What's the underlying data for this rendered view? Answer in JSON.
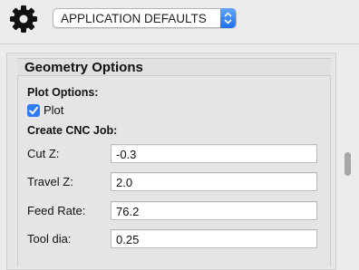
{
  "header": {
    "gear_icon": "gear-icon",
    "dropdown": {
      "selected": "APPLICATION DEFAULTS",
      "icon": "chevron-updown-icon"
    }
  },
  "section": {
    "title": "Geometry Options",
    "plot_options_label": "Plot Options:",
    "plot_checkbox": {
      "label": "Plot",
      "checked": true
    },
    "create_cnc_job_label": "Create CNC Job:",
    "fields": [
      {
        "label": "Cut Z:",
        "value": "-0.3"
      },
      {
        "label": "Travel Z:",
        "value": "2.0"
      },
      {
        "label": "Feed Rate:",
        "value": "76.2"
      },
      {
        "label": "Tool dia:",
        "value": "0.25"
      }
    ]
  },
  "colors": {
    "accent": "#2e7bf3",
    "background": "#ececec"
  }
}
